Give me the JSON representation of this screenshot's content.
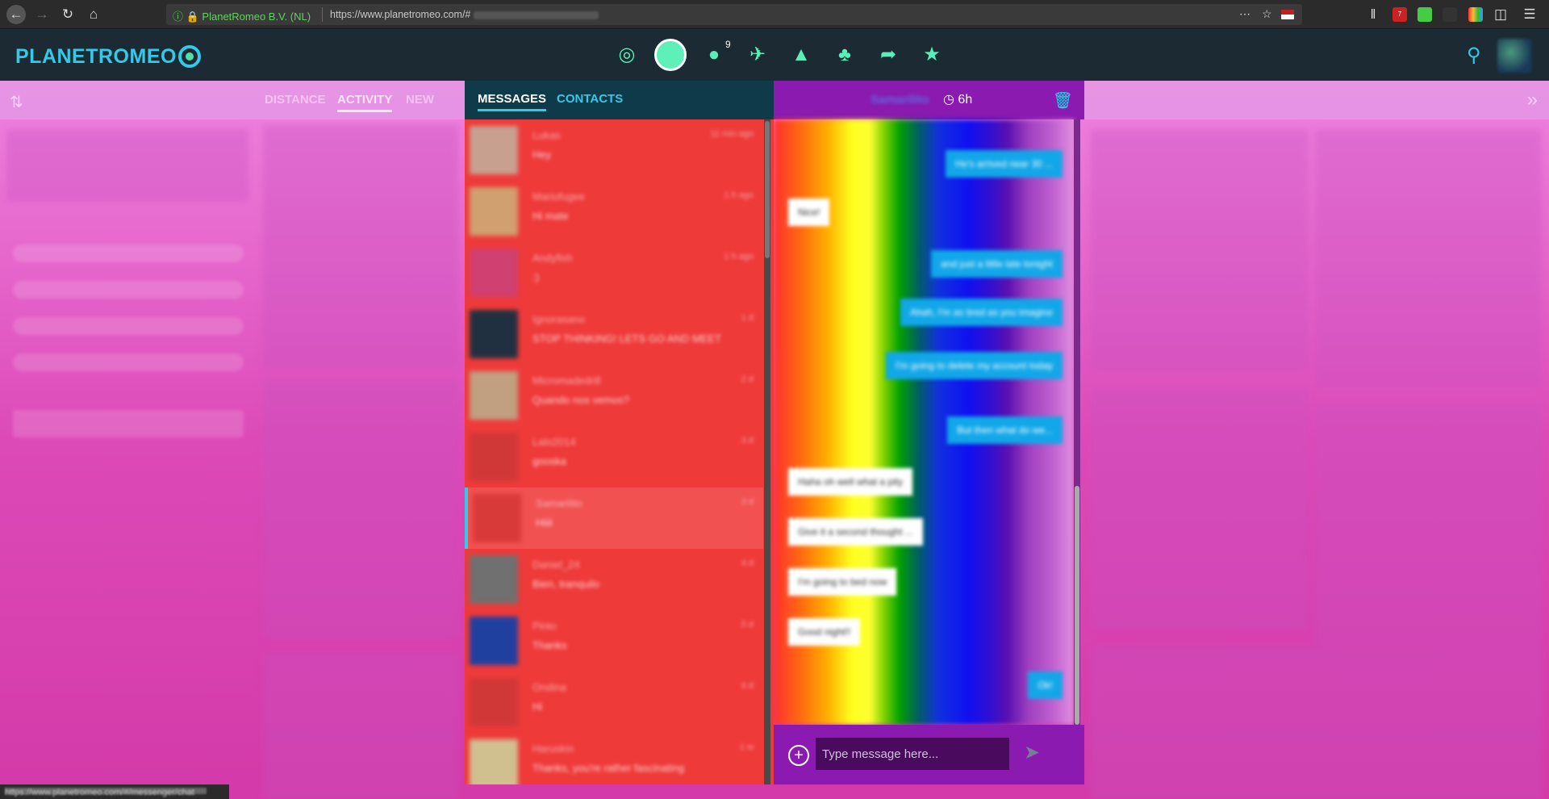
{
  "browser": {
    "site_identity": "PlanetRomeo B.V. (NL)",
    "url": "https://www.planetromeo.com/#",
    "ext_badge_count": "7"
  },
  "header": {
    "logo_text_a": "PLANET",
    "logo_text_b": "ROMEO",
    "footprints_badge": "9"
  },
  "filters": {
    "tabs": [
      "DISTANCE",
      "ACTIVITY",
      "NEW"
    ],
    "active_tab": "ACTIVITY"
  },
  "messages_panel": {
    "tabs": [
      "MESSAGES",
      "CONTACTS"
    ],
    "active_tab": "MESSAGES",
    "conversations": [
      {
        "name": "Lukas",
        "snippet": "Hey",
        "time": "11 min ago",
        "color": "#c8a090"
      },
      {
        "name": "Mariofugee",
        "snippet": "Hi mate",
        "time": "1 h ago",
        "color": "#d0a070"
      },
      {
        "name": "Andyfish",
        "snippet": ":)",
        "time": "1 h ago",
        "color": "#d04070"
      },
      {
        "name": "Ignorasano",
        "snippet": "STOP THINKING! LETS GO AND MEET",
        "time": "1 d",
        "color": "#203040"
      },
      {
        "name": "Micromadedrill",
        "snippet": "Quando nos vemos?",
        "time": "2 d",
        "color": "#c0a080"
      },
      {
        "name": "Lalo2014",
        "snippet": "gooska",
        "time": "3 d",
        "color": "#d03838"
      },
      {
        "name": "Samarilito",
        "snippet": "Hiiii",
        "time": "3 d",
        "color": "#d83a3a"
      },
      {
        "name": "Daniel_24",
        "snippet": "Bien, tranquilo",
        "time": "4 d",
        "color": "#707070"
      },
      {
        "name": "Pinto",
        "snippet": "Thanks",
        "time": "5 d",
        "color": "#2040a0"
      },
      {
        "name": "Ondina",
        "snippet": "Hi",
        "time": "6 d",
        "color": "#d03838"
      },
      {
        "name": "Haruskin",
        "snippet": "Thanks, you're rather fascinating",
        "time": "1 w",
        "color": "#d0c090"
      }
    ]
  },
  "chat": {
    "partner_name": "Samarilito",
    "online_since": "6h",
    "messages": [
      {
        "dir": "out",
        "text": "He's arrived near 30 ..."
      },
      {
        "dir": "in",
        "text": "Nice!"
      },
      {
        "dir": "out",
        "text": "and just a little late tonight"
      },
      {
        "dir": "out",
        "text": "Ahah, I'm as tired as you imagine"
      },
      {
        "dir": "out",
        "text": "I'm going to delete my account today"
      },
      {
        "dir": "out",
        "text": "But then what do we..."
      },
      {
        "dir": "in",
        "text": "Haha oh well what a pity"
      },
      {
        "dir": "in",
        "text": "Give it a second thought ..."
      },
      {
        "dir": "in",
        "text": "I'm going to bed now"
      },
      {
        "dir": "in",
        "text": "Good night!!"
      },
      {
        "dir": "out",
        "text": "Ok!"
      }
    ],
    "input_placeholder": "Type message here..."
  },
  "status_bar": {
    "text": "https://www.planetromeo.com/#/messenger/chat"
  },
  "colors": {
    "accent": "#34c9e8",
    "header_bg": "#1c2b33",
    "messages_bg": "#ef3a3a",
    "chat_header_bg": "#8a1ab0",
    "outgoing_bubble": "#12a7e8"
  }
}
